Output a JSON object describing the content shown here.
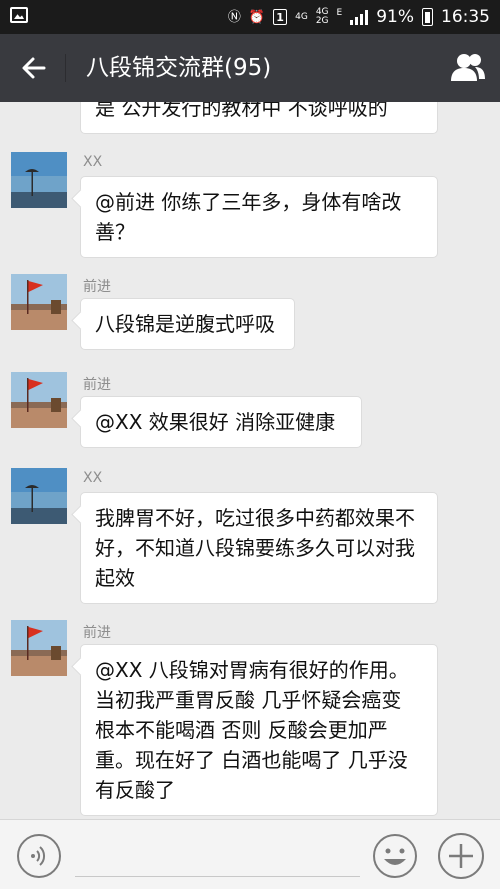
{
  "status_bar": {
    "network": "4G",
    "network2_top": "4G",
    "network2_bottom": "2G",
    "sim_label": "1",
    "data_type": "E",
    "battery": "91%",
    "time": "16:35"
  },
  "header": {
    "title": "八段锦交流群(95)",
    "back_icon": "arrow-left-icon",
    "members_icon": "group-members-icon"
  },
  "messages": [
    {
      "sender": "",
      "avatar": "none",
      "text": "是 公开发行的教材中 不谈呼吸的",
      "partial": true
    },
    {
      "sender": "XX",
      "avatar": "beach-umbrella-avatar",
      "text": "@前进 你练了三年多，身体有啥改善？"
    },
    {
      "sender": "前进",
      "avatar": "flag-avatar",
      "text": "八段锦是逆腹式呼吸"
    },
    {
      "sender": "前进",
      "avatar": "flag-avatar",
      "text": "@XX  效果很好  消除亚健康"
    },
    {
      "sender": "XX",
      "avatar": "beach-umbrella-avatar",
      "text": "我脾胃不好，吃过很多中药都效果不好，不知道八段锦要练多久可以对我起效"
    },
    {
      "sender": "前进",
      "avatar": "flag-avatar",
      "text": "@XX  八段锦对胃病有很好的作用。当初我严重胃反酸 几乎怀疑会癌变 根本不能喝酒 否则 反酸会更加严重。现在好了 白酒也能喝了 几乎没有反酸了"
    }
  ],
  "input_bar": {
    "voice_icon": "voice-input-icon",
    "emoji_icon": "emoji-icon",
    "plus_icon": "plus-icon"
  }
}
